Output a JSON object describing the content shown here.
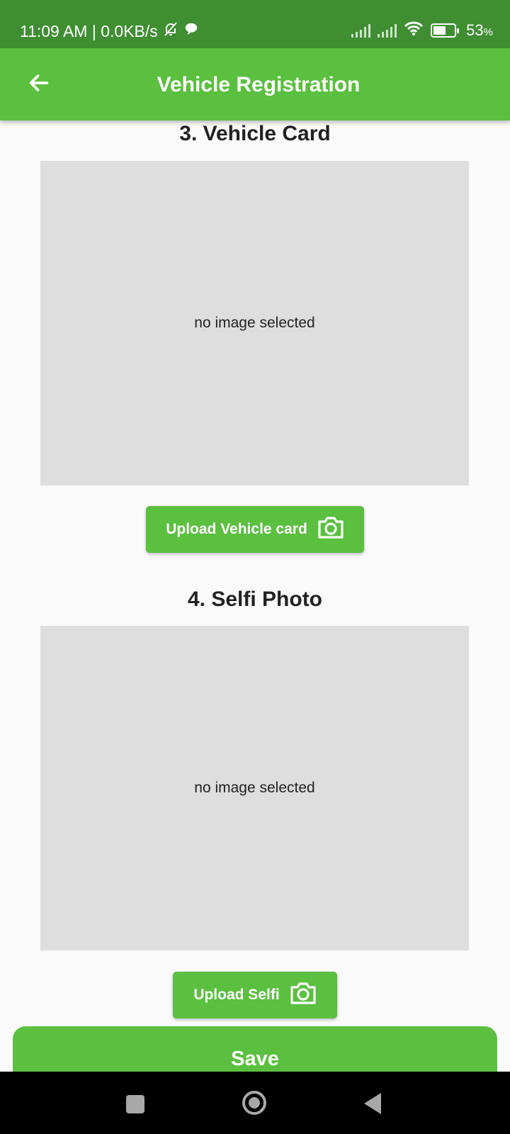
{
  "status_bar": {
    "time_info": "11:09 AM | 0.0KB/s",
    "battery_percent": "53",
    "battery_unit": "%",
    "icons": [
      "muted-bell-icon",
      "chat-bubble-icon",
      "signal-icon",
      "signal-icon",
      "wifi-icon",
      "battery-charging-icon"
    ]
  },
  "app_bar": {
    "title": "Vehicle Registration",
    "back_icon": "arrow-left-icon"
  },
  "sections": [
    {
      "title": "3. Vehicle Card",
      "placeholder": "no image selected",
      "button_label": "Upload Vehicle card",
      "button_icon": "camera-icon"
    },
    {
      "title": "4. Selfi Photo",
      "placeholder": "no image selected",
      "button_label": "Upload Selfi",
      "button_icon": "camera-icon"
    }
  ],
  "save_label": "Save",
  "nav_bar": {
    "icons": [
      "recents-icon",
      "home-icon",
      "back-icon"
    ]
  },
  "colors": {
    "status_bar": "#3f8e32",
    "primary": "#5bbf40",
    "image_placeholder": "#dedede",
    "background": "#fafafa"
  }
}
